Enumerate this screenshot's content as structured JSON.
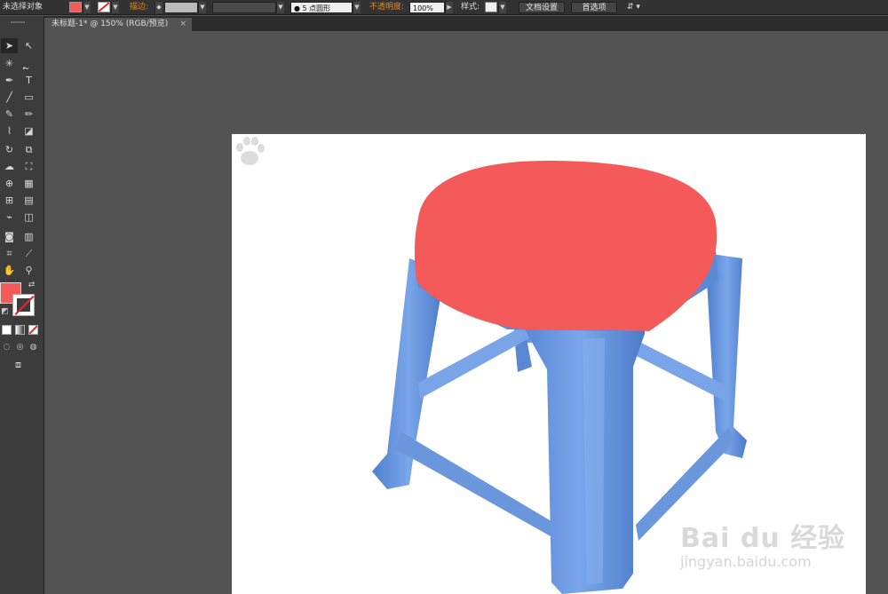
{
  "colors": {
    "fill": "#f55a5a",
    "stool": "#5d8fd9",
    "accent_label": "#e08a25"
  },
  "control_bar": {
    "selection_label": "未选择对象",
    "stroke_label": "描边:",
    "brush_label": "5 点圆形",
    "opacity_label": "不透明度:",
    "opacity_value": "100%",
    "style_label": "样式:",
    "doc_setup_button": "文档设置",
    "prefs_button": "首选项"
  },
  "tabs": [
    {
      "label": "未标题-1* @ 150% (RGB/预览)",
      "close": "×"
    }
  ],
  "watermark": {
    "main": "Bai du 经验",
    "sub": "jingyan.baidu.com"
  },
  "icons": {
    "selection": "selection-tool-icon",
    "direct_selection": "direct-selection-tool-icon",
    "magic_wand": "magic-wand-tool-icon",
    "lasso": "lasso-tool-icon",
    "pen": "pen-tool-icon",
    "type": "type-tool-icon",
    "line": "line-tool-icon",
    "rectangle": "rectangle-tool-icon",
    "paintbrush": "paintbrush-tool-icon",
    "pencil": "pencil-tool-icon",
    "blob_brush": "blob-brush-tool-icon",
    "eraser": "eraser-tool-icon",
    "rotate": "rotate-tool-icon",
    "scale": "scale-tool-icon",
    "warp": "warp-tool-icon",
    "free_transform": "free-transform-tool-icon",
    "shape_builder": "shape-builder-tool-icon",
    "perspective": "perspective-grid-tool-icon",
    "mesh": "mesh-tool-icon",
    "gradient": "gradient-tool-icon",
    "eyedropper": "eyedropper-tool-icon",
    "blend": "blend-tool-icon",
    "symbol_sprayer": "symbol-sprayer-tool-icon",
    "graph": "graph-tool-icon",
    "artboard": "artboard-tool-icon",
    "slice": "slice-tool-icon",
    "hand": "hand-tool-icon",
    "zoom": "zoom-tool-icon"
  }
}
